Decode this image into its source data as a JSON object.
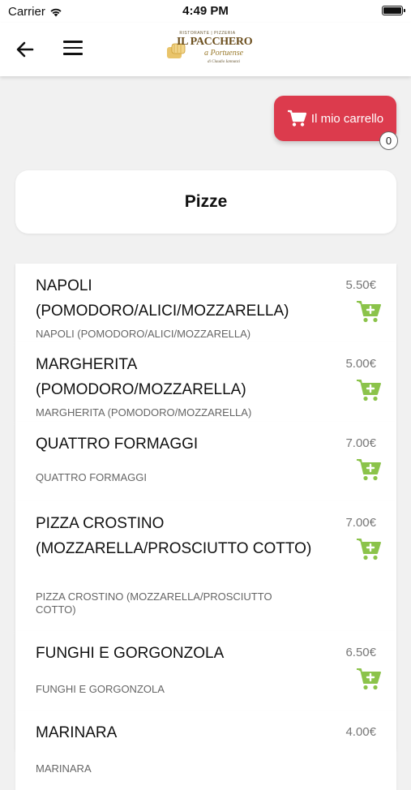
{
  "status_bar": {
    "carrier": "Carrier",
    "time": "4:49 PM"
  },
  "header": {
    "logo": {
      "top_text": "RISTORANTE | PIZZERIA",
      "main_text": "IL PACCHERO",
      "sub_text": "a Portuense",
      "by_text": "di Claudio Iannunzi"
    }
  },
  "cart": {
    "label": "Il mio carrello",
    "count": "0"
  },
  "category": {
    "title": "Pizze"
  },
  "colors": {
    "cart_red": "#dc3b4d",
    "add_green": "#8bc34a"
  },
  "products": [
    {
      "name": "NAPOLI (POMODORO/ALICI/MOZZARELLA)",
      "price": "5.50€",
      "description": "NAPOLI (POMODORO/ALICI/MOZZARELLA)"
    },
    {
      "name": "MARGHERITA (POMODORO/MOZZARELLA)",
      "price": "5.00€",
      "description": "MARGHERITA (POMODORO/MOZZARELLA)"
    },
    {
      "name": "QUATTRO FORMAGGI",
      "price": "7.00€",
      "description": "QUATTRO FORMAGGI"
    },
    {
      "name": "PIZZA CROSTINO (MOZZARELLA/PROSCIUTTO COTTO)",
      "price": "7.00€",
      "description": "PIZZA CROSTINO (MOZZARELLA/PROSCIUTTO COTTO)"
    },
    {
      "name": "FUNGHI E GORGONZOLA",
      "price": "6.50€",
      "description": "FUNGHI E GORGONZOLA"
    },
    {
      "name": "MARINARA",
      "price": "4.00€",
      "description": "MARINARA"
    }
  ]
}
